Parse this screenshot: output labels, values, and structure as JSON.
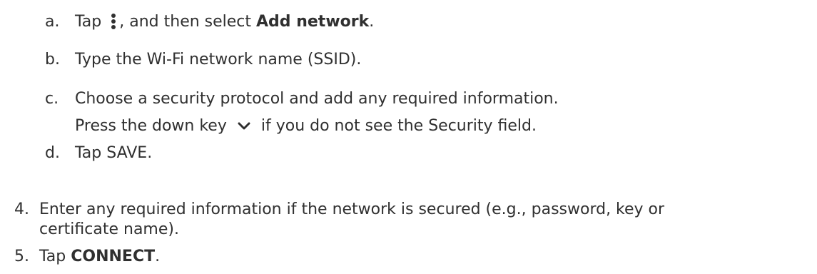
{
  "substeps": [
    {
      "marker": "a.",
      "pre": "Tap",
      "icon": "more-vert-icon",
      "mid": ", and then select",
      "bold": "Add network",
      "post": "."
    },
    {
      "marker": "b.",
      "text": "Type the Wi-Fi network name (SSID)."
    },
    {
      "marker": "c.",
      "text": "Choose a security protocol and add any required information.",
      "note_pre": "Press the down key",
      "note_icon": "chevron-down-icon",
      "note_post": "if you do not see the Security field."
    },
    {
      "marker": "d.",
      "text": "Tap SAVE."
    }
  ],
  "steps": [
    {
      "marker": "4.",
      "line1": "Enter any required information if the network is secured (e.g., password, key or",
      "line2": "certificate name)."
    },
    {
      "marker": "5.",
      "pre": "Tap",
      "bold": "CONNECT",
      "post": "."
    }
  ]
}
